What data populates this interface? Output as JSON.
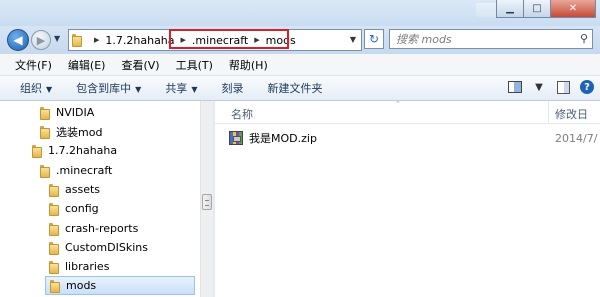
{
  "window": {
    "buttons": {
      "minimize": "▁",
      "maximize": "□",
      "close": "✕"
    }
  },
  "nav": {
    "back": "◀",
    "forward": "▶",
    "history": "▼"
  },
  "address": {
    "crumbs": [
      "1.7.2hahaha",
      ".minecraft",
      "mods"
    ],
    "sep": "▶",
    "dropdown": "▼",
    "refresh": "↻"
  },
  "search": {
    "placeholder": "搜索 mods",
    "icon": "⚲"
  },
  "menu": [
    "文件(F)",
    "编辑(E)",
    "查看(V)",
    "工具(T)",
    "帮助(H)"
  ],
  "commands": {
    "organize": "组织",
    "include_in_library": "包含到库中",
    "share": "共享",
    "burn": "刻录",
    "new_folder": "新建文件夹",
    "arrow": "▼",
    "view_options_arrow": "▼",
    "help": "?"
  },
  "tree": [
    {
      "label": "NVIDIA"
    },
    {
      "label": "选装mod"
    },
    {
      "label": "1.7.2hahaha"
    },
    {
      "label": ".minecraft"
    },
    {
      "label": "assets"
    },
    {
      "label": "config"
    },
    {
      "label": "crash-reports"
    },
    {
      "label": "CustomDISkins"
    },
    {
      "label": "libraries"
    },
    {
      "label": "mods"
    }
  ],
  "columns": {
    "name": "名称",
    "modified": "修改日",
    "sort_arrow": "⌃"
  },
  "files": [
    {
      "name": "我是MOD.zip",
      "date": "2014/7/"
    }
  ],
  "colors": {
    "accent": "#1e63b6",
    "highlight_border": "#d7202a"
  }
}
